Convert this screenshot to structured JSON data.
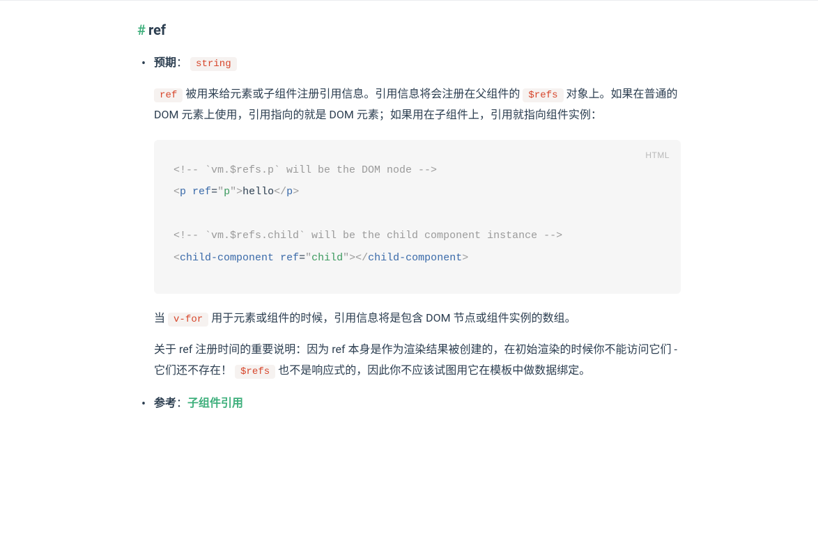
{
  "heading": {
    "anchor": "#",
    "text": "ref"
  },
  "expect": {
    "label": "预期",
    "type_code": "string"
  },
  "desc": {
    "pre1": " 被用来给元素或子组件注册引用信息。引用信息将会注册在父组件的 ",
    "post1": " 对象上。如果在普通的 DOM 元素上使用，引用指向的就是 DOM 元素；如果用在子组件上，引用就指向组件实例：",
    "code_ref": "ref",
    "code_refs": "$refs"
  },
  "codeblock": {
    "lang": "HTML",
    "c1_text": "<!-- `vm.$refs.p` will be the DOM node -->",
    "l2_open_lt": "<",
    "l2_tag": "p",
    "l2_sp": " ",
    "l2_attr": "ref",
    "l2_eq": "=",
    "l2_q": "\"",
    "l2_val": "p",
    "l2_gt": ">",
    "l2_text": "hello",
    "l2_close_lt": "</",
    "l2_close_tag": "p",
    "l2_close_gt": ">",
    "c2_text": "<!-- `vm.$refs.child` will be the child component instance -->",
    "l4_open_lt": "<",
    "l4_tag": "child-component",
    "l4_sp": " ",
    "l4_attr": "ref",
    "l4_eq": "=",
    "l4_q": "\"",
    "l4_val": "child",
    "l4_gt": ">",
    "l4_close_lt": "</",
    "l4_close_tag": "child-component",
    "l4_close_gt": ">"
  },
  "after_code": {
    "pre": "当 ",
    "code_vfor": "v-for",
    "post": " 用于元素或组件的时候，引用信息将是包含 DOM 节点或组件实例的数组。"
  },
  "note": {
    "pre": "关于 ref 注册时间的重要说明：因为 ref 本身是作为渲染结果被创建的，在初始渲染的时候你不能访问它们 - 它们还不存在！",
    "code_refs": "$refs",
    "post": " 也不是响应式的，因此你不应该试图用它在模板中做数据绑定。"
  },
  "reference": {
    "label": "参考",
    "link_text": "子组件引用"
  }
}
